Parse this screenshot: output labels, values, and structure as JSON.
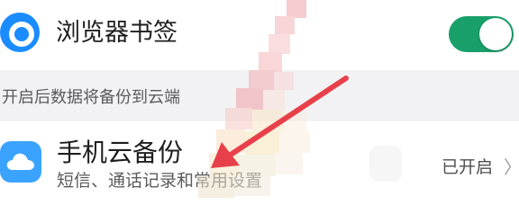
{
  "settings_rows": [
    {
      "title": "浏览器书签",
      "icon": "browser-icon",
      "toggle": {
        "state": "on",
        "color": "#19a06a"
      }
    }
  ],
  "section_note": "开启后数据将备份到云端",
  "backup_row": {
    "title": "手机云备份",
    "subtitle": "短信、通话记录和常用设置",
    "status": "已开启",
    "chevron": "〉",
    "icon": "cloud-icon"
  },
  "colors": {
    "accent_green": "#19a06a",
    "icon_blue": "#1a8cff",
    "cloud_blue": "#3aa3ff",
    "arrow_red": "#e8404a"
  }
}
